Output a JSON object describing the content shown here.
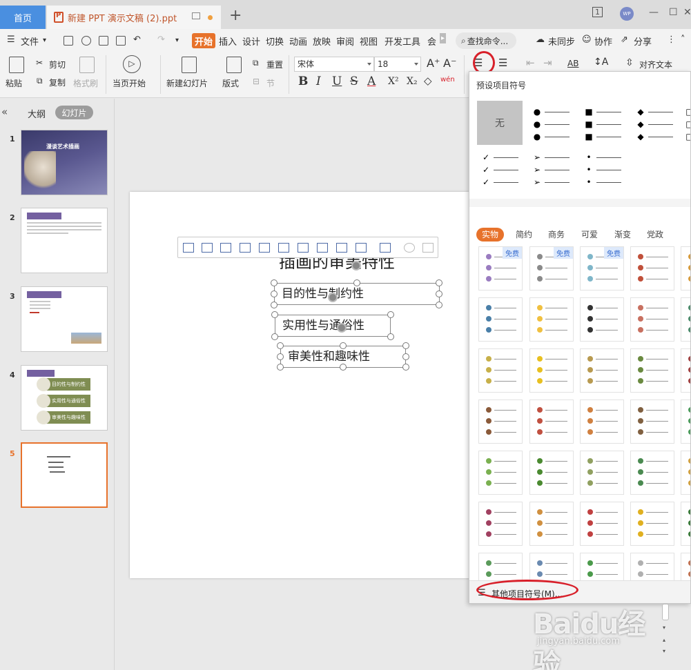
{
  "titlebar": {
    "home_tab": "首页",
    "doc_tab": "新建 PPT 演示文稿 (2).ppt",
    "page_indicator": "1",
    "avatar": "WP"
  },
  "menu": {
    "file": "文件",
    "start": "开始",
    "items": [
      "插入",
      "设计",
      "切换",
      "动画",
      "放映",
      "审阅",
      "视图",
      "开发工具",
      "会"
    ],
    "search": "查找命令...",
    "sync": "未同步",
    "collab": "协作",
    "share": "分享"
  },
  "ribbon": {
    "paste": "粘贴",
    "cut": "剪切",
    "copy": "复制",
    "format_painter": "格式刷",
    "from_current": "当页开始",
    "new_slide": "新建幻灯片",
    "layout": "版式",
    "reset": "重置",
    "section": "节",
    "font": "宋体",
    "size": "18",
    "bold": "B",
    "italic": "I",
    "underline": "U",
    "strike": "S",
    "font_color": "A",
    "superscript": "X²",
    "subscript": "X₂",
    "wen": "wén",
    "align_text": "对齐文本",
    "ab": "AB"
  },
  "leftpanel": {
    "tab_outline": "大纲",
    "tab_slides": "幻灯片",
    "slide_numbers": [
      "1",
      "2",
      "3",
      "4",
      "5"
    ],
    "slide1_title": "漫谈艺术插画",
    "slide4_items": [
      "目的性与制约性",
      "实用性与通俗性",
      "审美性与趣味性"
    ]
  },
  "slide": {
    "title": "插画的审美特性",
    "items": [
      "目的性与制约性",
      "实用性与通俗性",
      "审美性和趣味性"
    ]
  },
  "dropdown": {
    "title": "预设项目符号",
    "none": "无",
    "presets": [
      "●",
      "■",
      "◆",
      "□",
      "✓",
      "➢",
      "•"
    ],
    "categories": [
      "实物",
      "简约",
      "商务",
      "可爱",
      "渐变",
      "党政"
    ],
    "free_label": "免费",
    "more": "其他项目符号(M)..."
  },
  "watermark": {
    "main": "Baidu经验",
    "sub": "jingyan.baidu.com"
  },
  "colors": {
    "accent": "#e7722b",
    "home_tab": "#4a8fe0",
    "annotation": "#d8202a"
  }
}
